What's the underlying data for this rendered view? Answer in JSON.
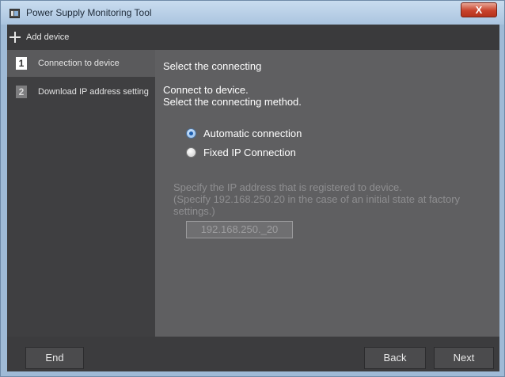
{
  "window": {
    "title": "Power Supply Monitoring Tool",
    "close_glyph": "X"
  },
  "toolbar": {
    "add_device_label": "Add device"
  },
  "sidebar": {
    "steps": [
      {
        "number": "1",
        "label": "Connection to device",
        "active": true
      },
      {
        "number": "2",
        "label": "Download IP address setting",
        "active": false
      }
    ]
  },
  "content": {
    "title": "Select the connecting",
    "description_line1": "Connect to device.",
    "description_line2": "Select the connecting method.",
    "options": [
      {
        "label": "Automatic connection",
        "selected": true
      },
      {
        "label": "Fixed IP Connection",
        "selected": false
      }
    ],
    "ip_description_line1": "Specify the IP address that is registered to device.",
    "ip_description_line2": "(Specify 192.168.250.20 in the case of an initial state at factory settings.)",
    "ip_value": "192.168.250._20"
  },
  "buttons": {
    "end": "End",
    "back": "Back",
    "next": "Next"
  },
  "colors": {
    "accent": "#1d5fb0",
    "panel": "#5f5f61",
    "sidebar": "#3f3f41"
  }
}
